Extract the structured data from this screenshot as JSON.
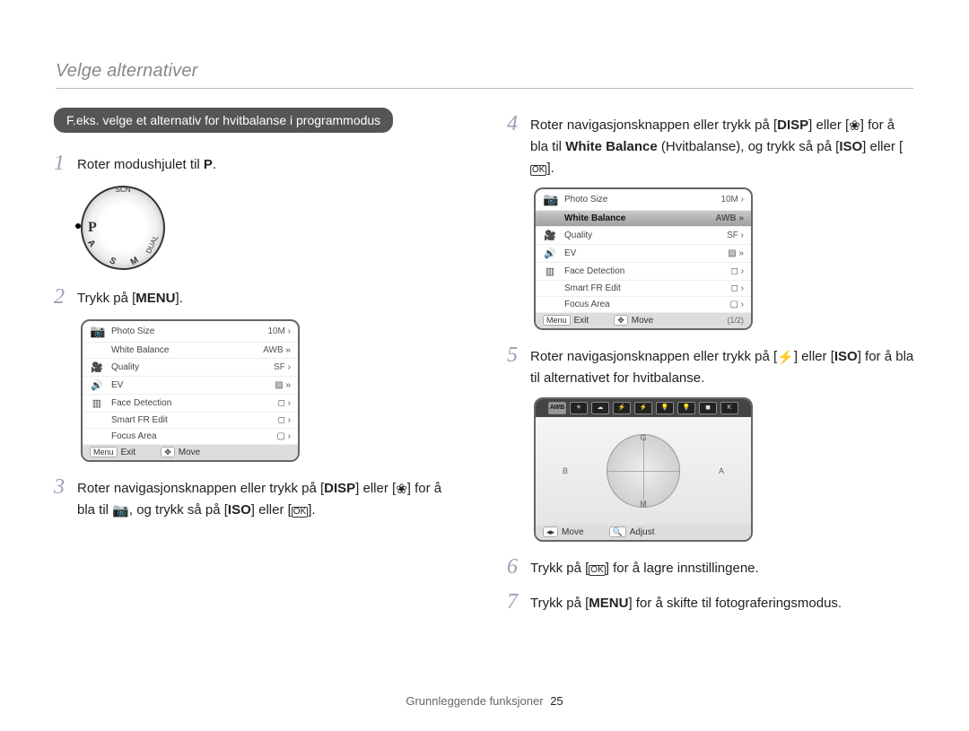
{
  "header": {
    "section_title": "Velge alternativer"
  },
  "banner": "F.eks. velge et alternativ for hvitbalanse i programmodus",
  "left": {
    "step1": {
      "num": "1",
      "text_a": "Roter modushjulet til ",
      "text_b": "."
    },
    "dial": {
      "selected": "P",
      "labels": {
        "top": "SCN",
        "left": "A",
        "b1": "S",
        "b2": "M",
        "right": "DUAL"
      }
    },
    "step2": {
      "num": "2",
      "text_a": "Trykk på [",
      "menu_label": "MENU",
      "text_b": "]."
    },
    "menu_screen": {
      "items": [
        {
          "icon": "📷",
          "label": "Photo Size",
          "right": "10M ›"
        },
        {
          "icon": "",
          "label": "White Balance",
          "right": "AWB »"
        },
        {
          "icon": "🎥",
          "label": "Quality",
          "right": "SF ›"
        },
        {
          "icon": "🔊",
          "label": "EV",
          "right": "▨ »"
        },
        {
          "icon": "▥",
          "label": "Face Detection",
          "right": "◻ ›"
        },
        {
          "icon": "",
          "label": "Smart FR Edit",
          "right": "◻ ›"
        },
        {
          "icon": "",
          "label": "Focus Area",
          "right": "▢ ›"
        }
      ],
      "footer": {
        "exit_tag": "Menu",
        "exit": "Exit",
        "move_ic": "✥",
        "move": "Move",
        "page": ""
      }
    },
    "step3": {
      "num": "3",
      "a": "Roter navigasjonsknappen eller trykk på [",
      "disp": "DISP",
      "b": "] eller [",
      "macro_ic": "❀",
      "c": "] for å bla til ",
      "cam_ic": "📷",
      "d": ", og trykk så på [",
      "iso": "ISO",
      "e": "] eller [",
      "ok": "OK",
      "f": "]."
    }
  },
  "right": {
    "step4": {
      "num": "4",
      "a": "Roter navigasjonsknappen eller trykk på [",
      "disp": "DISP",
      "b": "] eller [",
      "macro_ic": "❀",
      "c": "] for å bla til ",
      "wb_bold": "White Balance",
      "wb_paren": " (Hvitbalanse), og trykk så på [",
      "iso": "ISO",
      "d": "] eller [",
      "ok": "OK",
      "e": "]."
    },
    "menu_screen": {
      "items": [
        {
          "icon": "📷",
          "label": "Photo Size",
          "right": "10M ›"
        },
        {
          "icon": "",
          "label": "White Balance",
          "right": "AWB »",
          "selected": true
        },
        {
          "icon": "🎥",
          "label": "Quality",
          "right": "SF ›"
        },
        {
          "icon": "🔊",
          "label": "EV",
          "right": "▨ »"
        },
        {
          "icon": "▥",
          "label": "Face Detection",
          "right": "◻ ›"
        },
        {
          "icon": "",
          "label": "Smart FR Edit",
          "right": "◻ ›"
        },
        {
          "icon": "",
          "label": "Focus Area",
          "right": "▢ ›"
        }
      ],
      "footer": {
        "exit_tag": "Menu",
        "exit": "Exit",
        "move_ic": "✥",
        "move": "Move",
        "page": "(1/2)"
      }
    },
    "step5": {
      "num": "5",
      "a": "Roter navigasjonsknappen eller trykk på [",
      "flash_ic": "⚡",
      "b": "] eller [",
      "iso": "ISO",
      "c": "] for å bla til alternativet for hvitbalanse."
    },
    "wb_screen": {
      "strip": [
        "AWB",
        "☀",
        "☁",
        "⚡",
        "⚡",
        "💡",
        "💡",
        "◼",
        "K"
      ],
      "strip_selected_index": 0,
      "axes": {
        "g": "G",
        "m": "M",
        "b": "B",
        "a": "A"
      },
      "footer": {
        "move_ic": "◂▸",
        "move": "Move",
        "adjust_ic": "🔍",
        "adjust": "Adjust"
      }
    },
    "step6": {
      "num": "6",
      "a": "Trykk på [",
      "ok": "OK",
      "b": "] for å lagre innstillingene."
    },
    "step7": {
      "num": "7",
      "a": "Trykk på [",
      "menu_label": "MENU",
      "b": "] for å skifte til fotograferingsmodus."
    }
  },
  "footer": {
    "text": "Grunnleggende funksjoner",
    "page": "25"
  }
}
